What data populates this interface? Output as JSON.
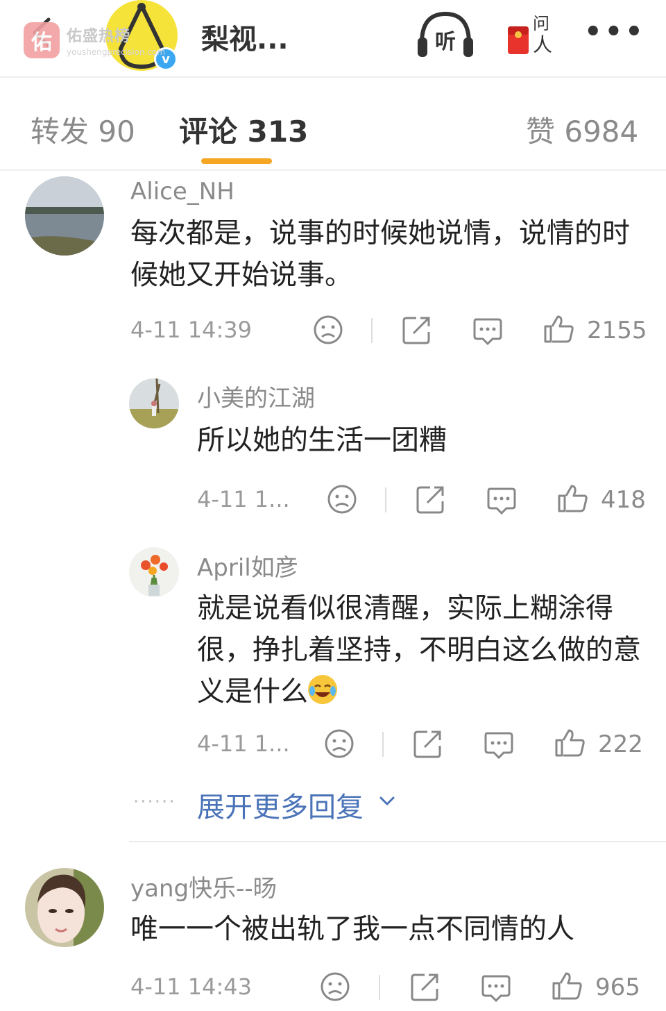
{
  "header": {
    "title": "梨视...",
    "watermark_name": "佑盛热榜",
    "watermark_logo": "佑",
    "watermark_url": "youshengprecision.com",
    "verified_badge": "v",
    "listen_icon_label": "听",
    "ask_icon_label": "问人"
  },
  "tabs": [
    {
      "label": "转发 90"
    },
    {
      "label": "评论 313"
    },
    {
      "label": "赞 6984"
    }
  ],
  "comments": [
    {
      "user": "Alice_NH",
      "text": "每次都是，说事的时候她说情，说情的时候她又开始说事。",
      "time": "4-11 14:39",
      "likes": "2155"
    },
    {
      "user": "小美的江湖",
      "text": "所以她的生活一团糟",
      "time": "4-11 1...",
      "likes": "418"
    },
    {
      "user": "April如彦",
      "text": "就是说看似很清醒，实际上糊涂得很，挣扎着坚持，不明白这么做的意义是什么",
      "time": "4-11 1...",
      "likes": "222"
    },
    {
      "user": "yang快乐--旸",
      "text": "唯一一个被出轨了我一点不同情的人",
      "time": "4-11 14:43",
      "likes": "965"
    }
  ],
  "expand_more": "展开更多回复",
  "expand_dots": "······",
  "colors": {
    "accent": "#f5a623",
    "link": "#4a73b8",
    "verified": "#3aa7f0"
  }
}
